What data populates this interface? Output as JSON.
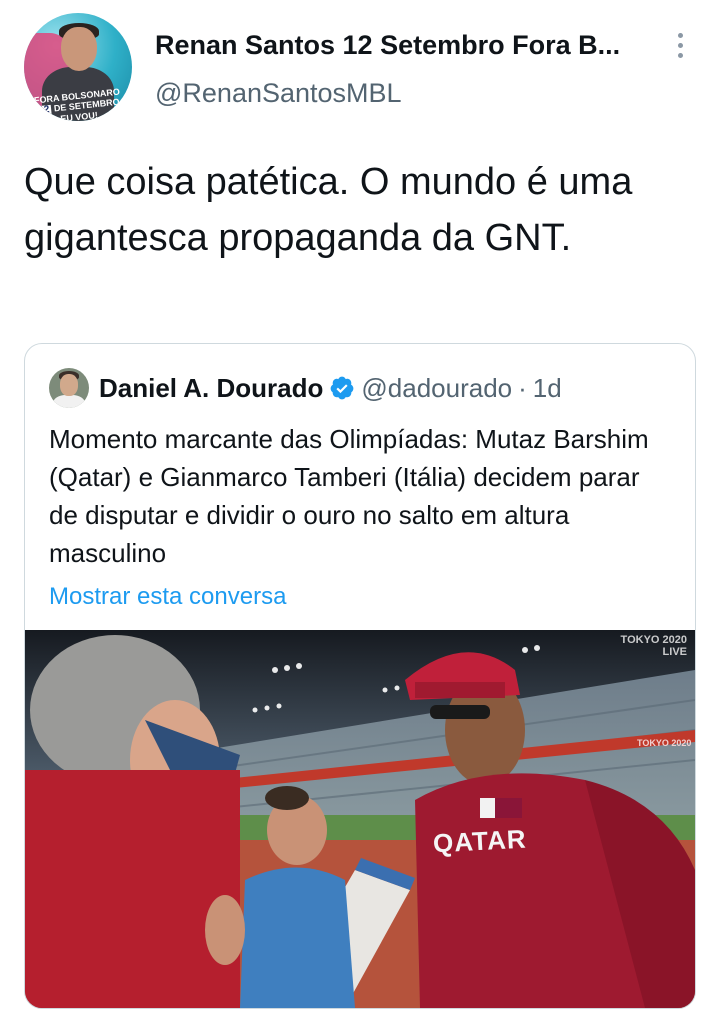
{
  "tweet": {
    "author_name": "Renan Santos 12 Setembro Fora B...",
    "author_handle": "@RenanSantosMBL",
    "text": "Que coisa patética. O mundo é uma gigantesca propaganda da GNT.",
    "avatar_badge": {
      "line1": "FORA BOLSONARO",
      "number": "12",
      "line2": "DE SETEMBRO",
      "line3": "EU VOU!"
    }
  },
  "quoted": {
    "author_name": "Daniel A. Dourado",
    "author_handle": "@dadourado",
    "separator": "·",
    "time": "1d",
    "text": "Momento marcante das Olimpíadas: Mutaz Barshim (Qatar) e Gianmarco Tamberi (Itália) decidem parar de disputar e dividir o ouro no salto em altura masculino",
    "show_thread_label": "Mostrar esta conversa",
    "media": {
      "watermark_line1": "TOKYO 2020",
      "watermark_line2": "LIVE",
      "jersey_text": "QATAR",
      "banner_text": "TOKYO 2020"
    }
  },
  "colors": {
    "text_primary": "#0f1419",
    "text_secondary": "#536471",
    "link": "#1d9bf0",
    "verified": "#1d9bf0",
    "border": "#cfd9de"
  },
  "icons": {
    "more": "more-vertical-icon",
    "verified": "verified-badge-icon"
  }
}
